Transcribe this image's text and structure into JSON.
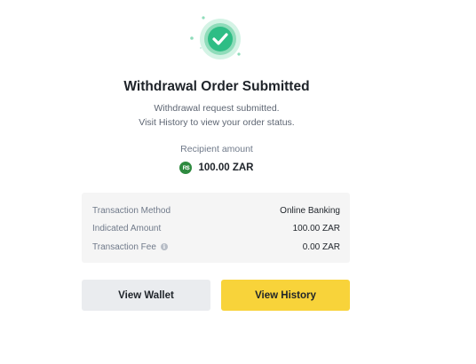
{
  "status": {
    "title": "Withdrawal Order Submitted",
    "message_line1": "Withdrawal request submitted.",
    "message_line2": "Visit History to view your order status."
  },
  "recipient": {
    "label": "Recipient amount",
    "currency_badge": "R$",
    "amount": "100.00 ZAR"
  },
  "details": [
    {
      "label": "Transaction Method",
      "value": "Online Banking"
    },
    {
      "label": "Indicated Amount",
      "value": "100.00 ZAR"
    },
    {
      "label": "Transaction Fee",
      "value": "0.00 ZAR"
    }
  ],
  "info_icon_glyph": "i",
  "buttons": {
    "view_wallet": "View Wallet",
    "view_history": "View History"
  },
  "colors": {
    "success_green": "#2ebd85",
    "primary_yellow": "#f8d33a",
    "secondary_gray": "#eaecef",
    "currency_badge_green": "#2e8a3f"
  },
  "icons": {
    "success": "check-circle-icon",
    "info": "info-icon"
  }
}
